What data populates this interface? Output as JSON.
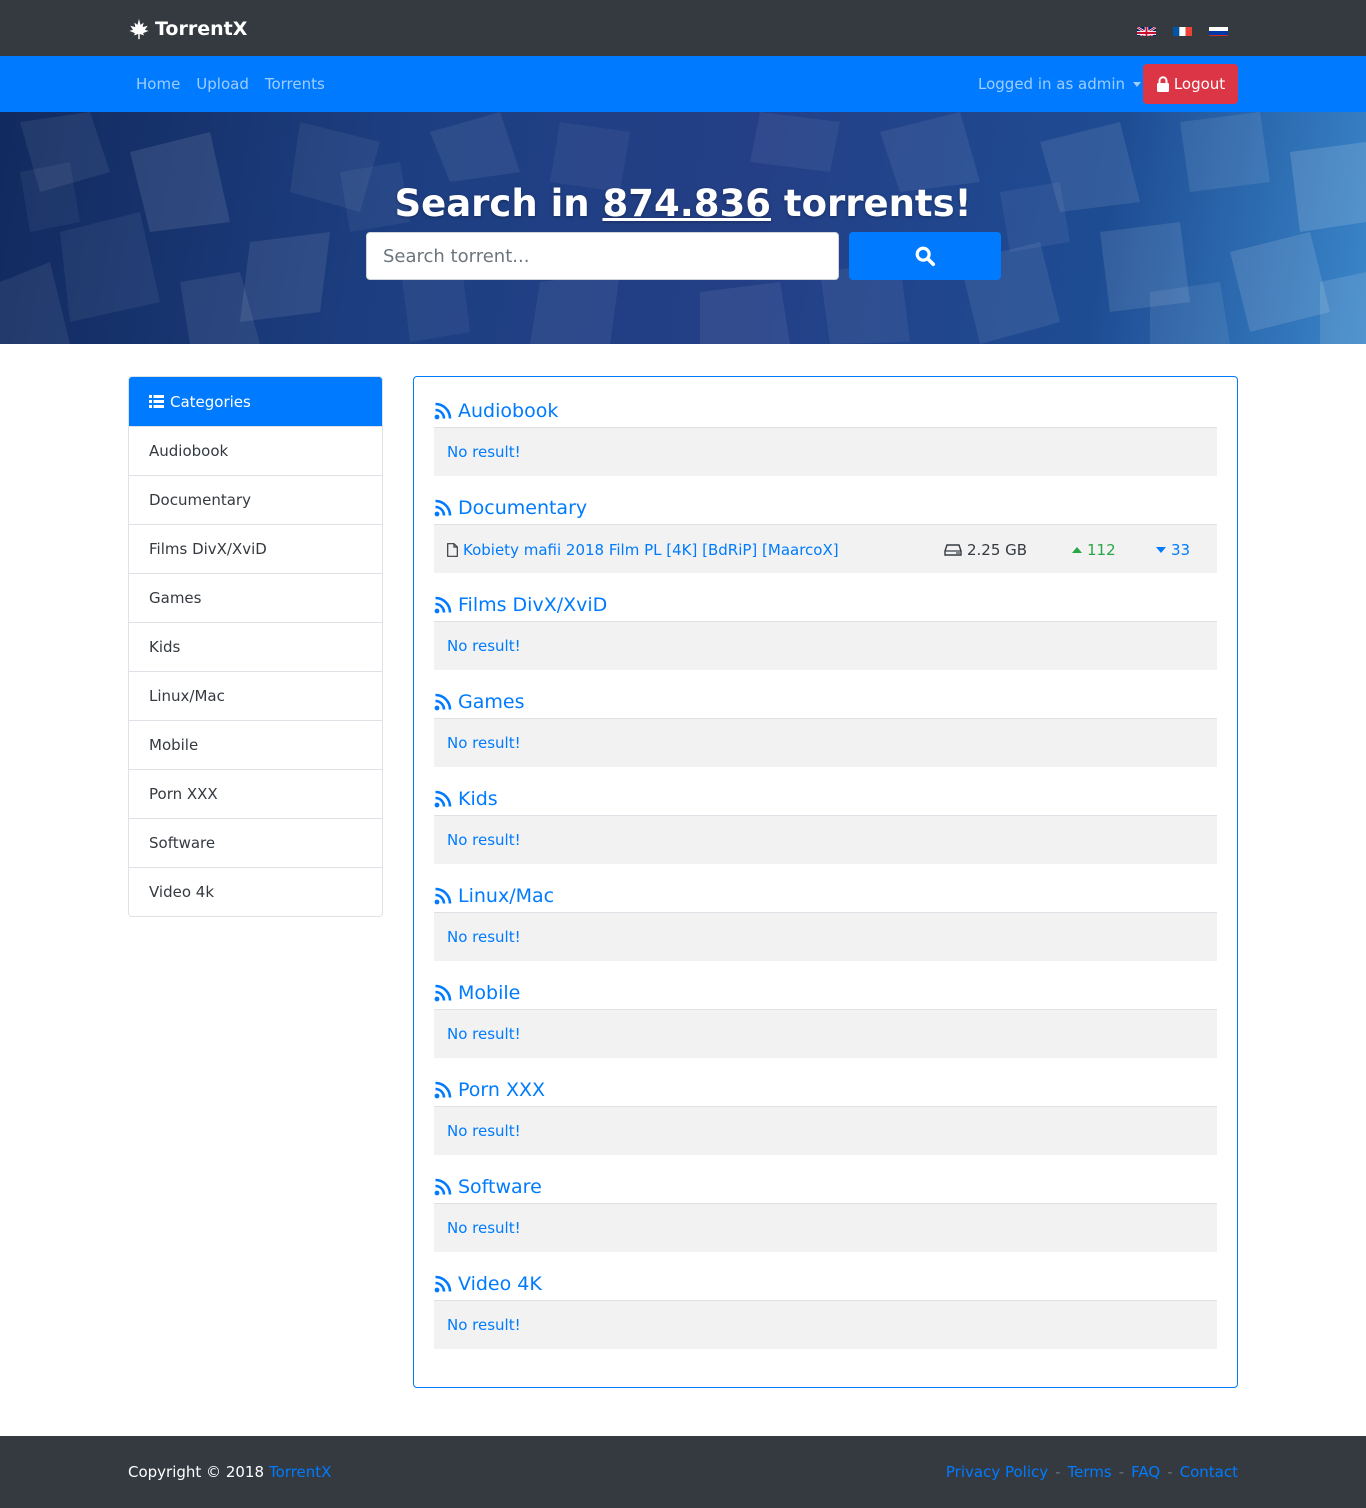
{
  "brand": {
    "name": "TorrentX",
    "icon": "leaf-icon"
  },
  "languages": [
    {
      "code": "en",
      "icon": "uk-flag-icon"
    },
    {
      "code": "fr",
      "icon": "france-flag-icon"
    },
    {
      "code": "ru",
      "icon": "russia-flag-icon"
    }
  ],
  "nav": {
    "home": "Home",
    "upload": "Upload",
    "torrents": "Torrents",
    "user": "Logged in as admin",
    "logout": "Logout"
  },
  "hero": {
    "title_prefix": "Search in ",
    "count": "874.836",
    "title_suffix": " torrents!",
    "search_placeholder": "Search torrent..."
  },
  "sidebar": {
    "header": "Categories",
    "items": [
      {
        "label": "Audiobook"
      },
      {
        "label": "Documentary"
      },
      {
        "label": "Films DivX/XviD"
      },
      {
        "label": "Games"
      },
      {
        "label": "Kids"
      },
      {
        "label": "Linux/Mac"
      },
      {
        "label": "Mobile"
      },
      {
        "label": "Porn XXX"
      },
      {
        "label": "Software"
      },
      {
        "label": "Video 4k"
      }
    ]
  },
  "sections": [
    {
      "title": "Audiobook",
      "empty": "No result!"
    },
    {
      "title": "Documentary",
      "torrent": {
        "name": "Kobiety mafii 2018 Film PL [4K] [BdRiP] [MaarcoX]",
        "size": "2.25 GB",
        "seeders": "112",
        "leechers": "33"
      }
    },
    {
      "title": "Films DivX/XviD",
      "empty": "No result!"
    },
    {
      "title": "Games",
      "empty": "No result!"
    },
    {
      "title": "Kids",
      "empty": "No result!"
    },
    {
      "title": "Linux/Mac",
      "empty": "No result!"
    },
    {
      "title": "Mobile",
      "empty": "No result!"
    },
    {
      "title": "Porn XXX",
      "empty": "No result!"
    },
    {
      "title": "Software",
      "empty": "No result!"
    },
    {
      "title": "Video 4K",
      "empty": "No result!"
    }
  ],
  "footer": {
    "copyright": "Copyright © 2018",
    "brand_link": "TorrentX",
    "links": {
      "privacy": "Privacy Policy",
      "terms": "Terms",
      "faq": "FAQ",
      "contact": "Contact"
    },
    "separator": "-"
  },
  "colors": {
    "primary": "#007bff",
    "dark": "#343a40",
    "danger": "#dc3545",
    "success": "#28a745",
    "row_bg": "#f2f2f2"
  }
}
